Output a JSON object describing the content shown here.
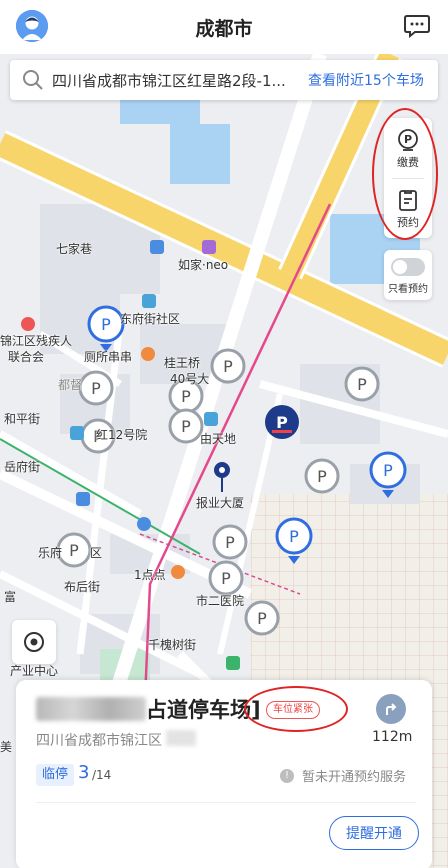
{
  "header": {
    "title": "成都市"
  },
  "search": {
    "address": "四川省成都市锦江区红星路2段-1...",
    "nearby_link": "查看附近15个车场"
  },
  "tools": {
    "pay_label": "缴费",
    "reserve_label": "预约"
  },
  "toggle": {
    "label": "只看预约",
    "on": false
  },
  "map_labels": {
    "rujia": "如家·neo",
    "fangjie": "东府街社区",
    "cansheng": "锦江区残疾人",
    "lianhe": "联合会",
    "cesuo": "厕所串串",
    "guiwang": "桂王桥",
    "hao40": "40号大",
    "duting": "都督",
    "heping": "和平街",
    "yuefu": "岳府街",
    "yuan12": "红12号院",
    "tiandi": "由天地",
    "baoye": "报业大厦",
    "lefu": "乐府",
    "qu": "区",
    "houhou": "布后街",
    "fu": "富",
    "diandian": "1点点",
    "yiyuan": "市二医院",
    "qianhuai": "千槐树街",
    "chanye": "产业中心",
    "qijia": "七家巷",
    "meiyu": "美"
  },
  "lot": {
    "name": "占道停车场]",
    "status_tag": "车位紧张",
    "address": "四川省成都市锦江区",
    "distance": "112m",
    "type": "临停",
    "available": "3",
    "total": "/14",
    "notice": "暂未开通预约服务",
    "remind_button": "提醒开通"
  },
  "colors": {
    "accent": "#2f6ee0",
    "warning": "#e44444",
    "road_major": "#f7d56a",
    "water": "#a9d2f3",
    "park": "#c6e8d3"
  }
}
